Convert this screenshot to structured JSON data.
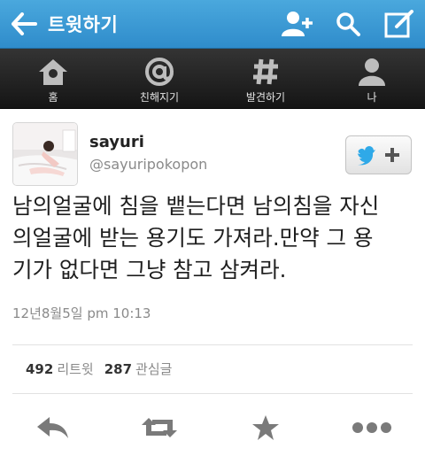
{
  "topbar": {
    "title": "트윗하기"
  },
  "nav": {
    "items": [
      {
        "label": "홈",
        "icon": "home-icon"
      },
      {
        "label": "친해지기",
        "icon": "at-icon"
      },
      {
        "label": "발견하기",
        "icon": "hash-icon"
      },
      {
        "label": "나",
        "icon": "person-icon"
      }
    ]
  },
  "tweet": {
    "display_name": "sayuri",
    "handle": "@sayuripokopon",
    "text_lines": [
      "남의얼굴에 침을 뱉는다면 남의침을 자신",
      "의얼굴에 받는 용기도 가져라.만약 그 용",
      "기가 없다면 그냥 참고 삼켜라."
    ],
    "timestamp": "12년8월5일 pm 10:13",
    "retweets": {
      "count": "492",
      "label": "리트윗"
    },
    "favorites": {
      "count": "287",
      "label": "관심글"
    }
  },
  "colors": {
    "header_blue": "#3a98d4",
    "nav_dark": "#1e1e1e",
    "twitter_bird": "#2fa9e8"
  }
}
